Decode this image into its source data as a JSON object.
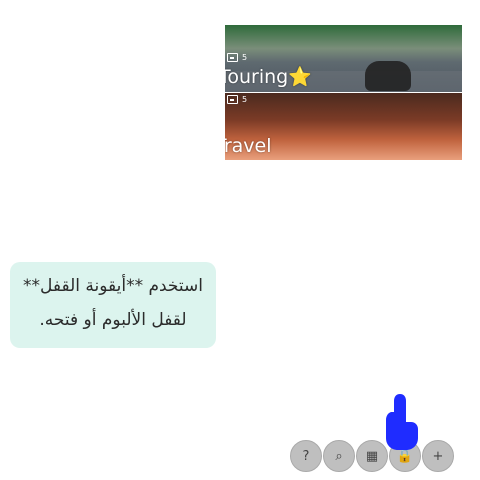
{
  "albums": [
    {
      "title": "Touring⭐",
      "count": "5"
    },
    {
      "title": "Travel",
      "count": "5"
    }
  ],
  "tip": {
    "line1": "استخدم **أيقونة القفل**",
    "line2": "لقفل الألبوم أو فتحه."
  },
  "toolbar": {
    "buttons": [
      {
        "icon": "help-icon",
        "glyph": "?"
      },
      {
        "icon": "search-icon",
        "glyph": "⌕"
      },
      {
        "icon": "grid-icon",
        "glyph": "▦"
      },
      {
        "icon": "lock-icon",
        "glyph": "🔒"
      },
      {
        "icon": "add-icon",
        "glyph": "+"
      }
    ]
  },
  "colors": {
    "tip_bg": "#dcf4ee",
    "fab_bg": "#bfbfbf",
    "pointer": "#1f2cff"
  }
}
